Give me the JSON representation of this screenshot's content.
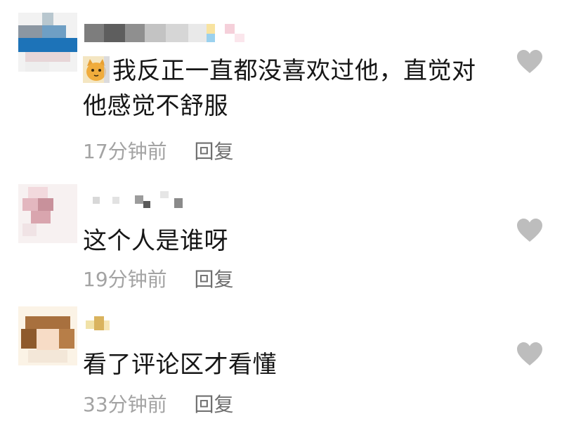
{
  "comments": [
    {
      "text_line1": "我反正一直都没喜欢过他，直觉对",
      "text_line2": "他感觉不舒服",
      "time": "17分钟前",
      "reply": "回复",
      "emoji": "cat-emoji"
    },
    {
      "text": "这个人是谁呀",
      "time": "19分钟前",
      "reply": "回复"
    },
    {
      "text": "看了评论区才看懂",
      "time": "33分钟前",
      "reply": "回复"
    }
  ],
  "icons": {
    "like": "heart-icon"
  },
  "colors": {
    "like_icon": "#bdbdbd",
    "time_text": "#a3a3a3",
    "reply_text": "#6f6f6f"
  }
}
